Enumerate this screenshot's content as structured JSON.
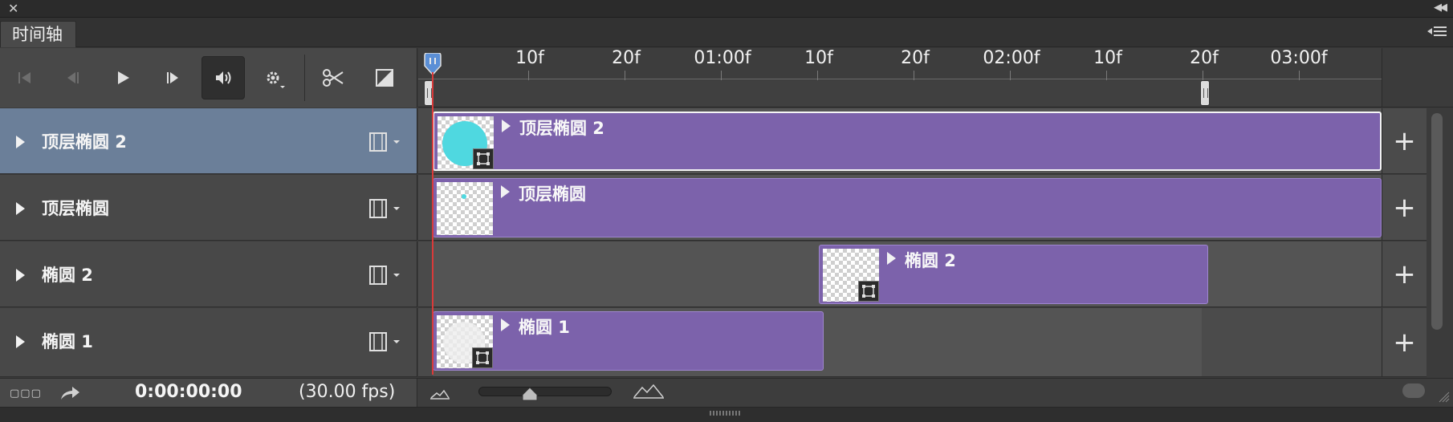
{
  "window": {
    "close_icon": "close-icon",
    "collapse_icon": "double-chevron-left-icon"
  },
  "tab": {
    "label": "时间轴"
  },
  "toolbar": {
    "buttons": [
      "go-to-first-frame-icon",
      "previous-frame-icon",
      "play-icon",
      "next-frame-icon",
      "audio-icon",
      "settings-icon",
      "split-at-playhead-icon",
      "transition-icon"
    ]
  },
  "ruler": {
    "labels": [
      "10f",
      "20f",
      "01:00f",
      "10f",
      "20f",
      "02:00f",
      "10f",
      "20f",
      "03:00f"
    ]
  },
  "layers": [
    {
      "name": "顶层椭圆 2",
      "selected": true
    },
    {
      "name": "顶层椭圆",
      "selected": false
    },
    {
      "name": "椭圆 2",
      "selected": false
    },
    {
      "name": "椭圆 1",
      "selected": false
    }
  ],
  "clips": [
    {
      "name": "顶层椭圆 2",
      "thumbnail": "cyan-circle"
    },
    {
      "name": "顶层椭圆",
      "thumbnail": "cyan-dot"
    },
    {
      "name": "椭圆 2",
      "thumbnail": "transparent"
    },
    {
      "name": "椭圆 1",
      "thumbnail": "light-circle"
    }
  ],
  "colors": {
    "clip": "#7c62ab",
    "selected_layer": "#6b7f99",
    "playhead": "#d93a3a",
    "thumb_cyan": "#4fd8e0"
  },
  "bottom": {
    "timecode": "0:00:00:00",
    "fps": "(30.00 fps)"
  }
}
